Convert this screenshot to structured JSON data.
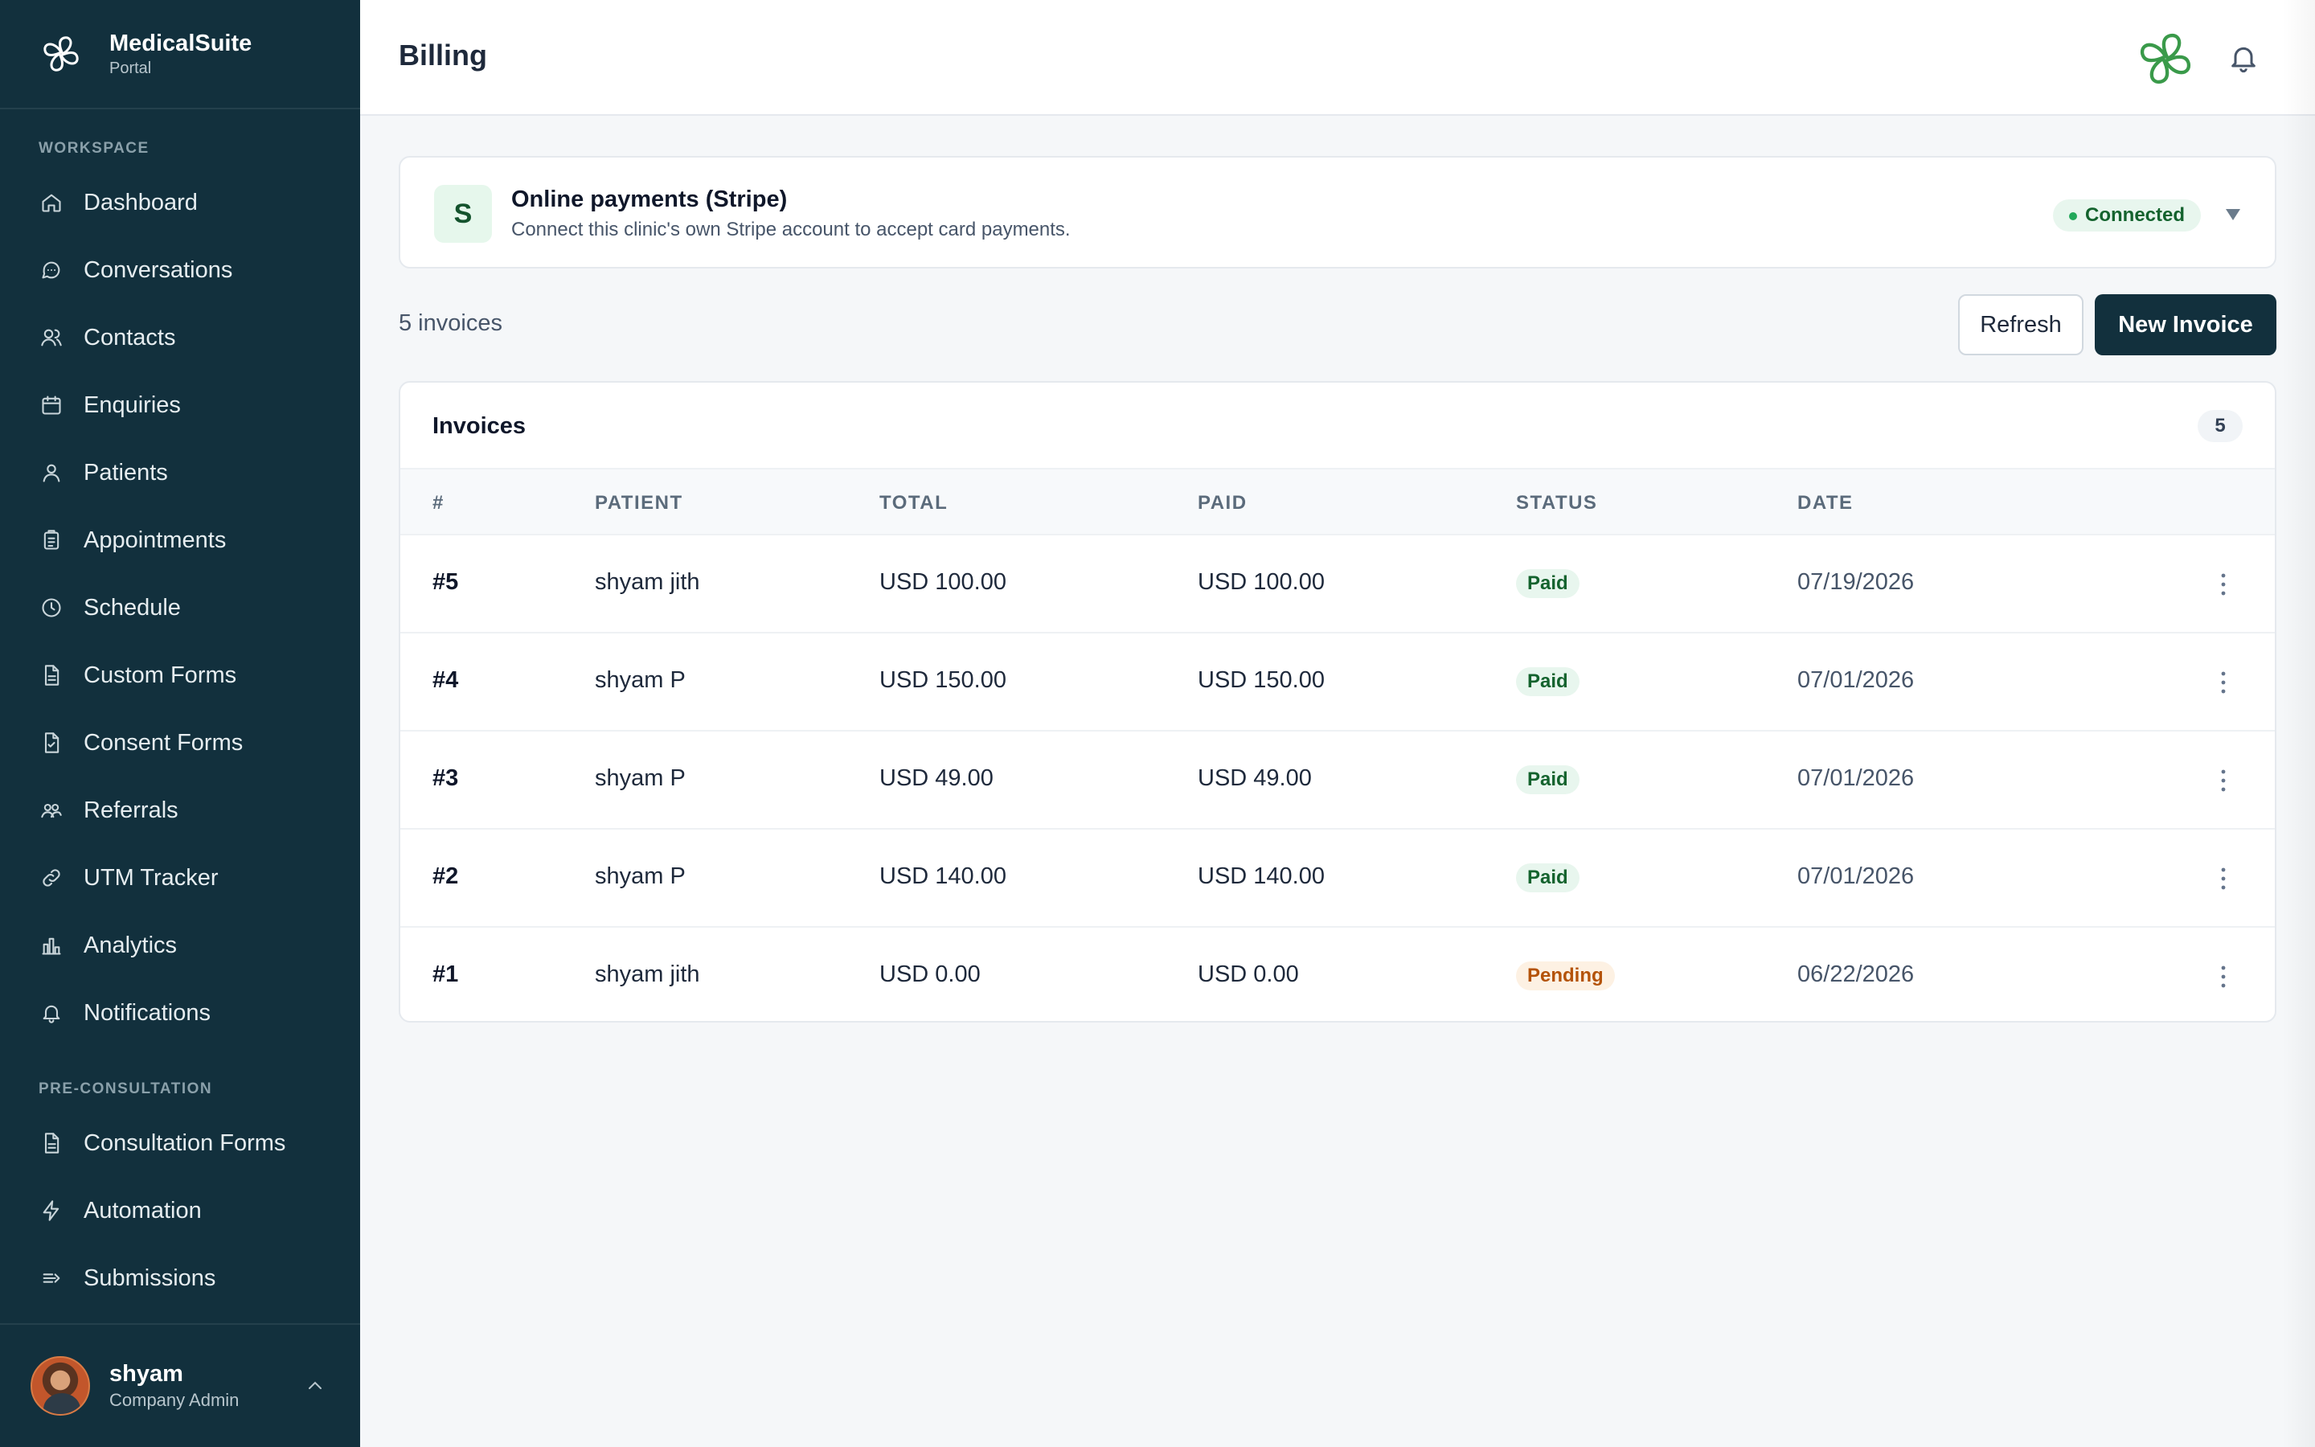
{
  "brand": {
    "name": "MedicalSuite",
    "subtitle": "Portal"
  },
  "sidebar": {
    "sections": [
      {
        "label": "WORKSPACE"
      },
      {
        "label": "PRE-CONSULTATION"
      }
    ],
    "items": [
      {
        "label": "Dashboard",
        "icon": "home-icon"
      },
      {
        "label": "Conversations",
        "icon": "chat-icon"
      },
      {
        "label": "Contacts",
        "icon": "contacts-icon"
      },
      {
        "label": "Enquiries",
        "icon": "calendar-icon"
      },
      {
        "label": "Patients",
        "icon": "user-icon"
      },
      {
        "label": "Appointments",
        "icon": "clipboard-icon"
      },
      {
        "label": "Schedule",
        "icon": "clock-icon"
      },
      {
        "label": "Custom Forms",
        "icon": "document-icon"
      },
      {
        "label": "Consent Forms",
        "icon": "document-check-icon"
      },
      {
        "label": "Referrals",
        "icon": "users-icon"
      },
      {
        "label": "UTM Tracker",
        "icon": "link-icon"
      },
      {
        "label": "Analytics",
        "icon": "bar-chart-icon"
      },
      {
        "label": "Notifications",
        "icon": "bell-icon"
      }
    ],
    "pre_items": [
      {
        "label": "Consultation Forms",
        "icon": "document-icon"
      },
      {
        "label": "Automation",
        "icon": "bolt-icon"
      },
      {
        "label": "Submissions",
        "icon": "submit-icon"
      }
    ]
  },
  "user": {
    "name": "shyam",
    "role": "Company Admin"
  },
  "header": {
    "title": "Billing"
  },
  "stripe": {
    "letter": "S",
    "title": "Online payments (Stripe)",
    "description": "Connect this clinic's own Stripe account to accept card payments.",
    "status": "Connected"
  },
  "toolbar": {
    "count_text": "5 invoices",
    "refresh_label": "Refresh",
    "new_label": "New Invoice"
  },
  "table": {
    "title": "Invoices",
    "count": "5",
    "columns": [
      "#",
      "PATIENT",
      "TOTAL",
      "PAID",
      "STATUS",
      "DATE"
    ],
    "rows": [
      {
        "num": "#5",
        "patient": "shyam jith",
        "total": "USD 100.00",
        "paid": "USD 100.00",
        "status": "Paid",
        "date": "07/19/2026"
      },
      {
        "num": "#4",
        "patient": "shyam P",
        "total": "USD 150.00",
        "paid": "USD 150.00",
        "status": "Paid",
        "date": "07/01/2026"
      },
      {
        "num": "#3",
        "patient": "shyam P",
        "total": "USD 49.00",
        "paid": "USD 49.00",
        "status": "Paid",
        "date": "07/01/2026"
      },
      {
        "num": "#2",
        "patient": "shyam P",
        "total": "USD 140.00",
        "paid": "USD 140.00",
        "status": "Paid",
        "date": "07/01/2026"
      },
      {
        "num": "#1",
        "patient": "shyam jith",
        "total": "USD 0.00",
        "paid": "USD 0.00",
        "status": "Pending",
        "date": "06/22/2026"
      }
    ]
  },
  "colors": {
    "sidebar_bg": "#12303d",
    "accent": "#12303d",
    "paid": "#14632e",
    "pending": "#b45309",
    "connected": "#22a85a"
  }
}
